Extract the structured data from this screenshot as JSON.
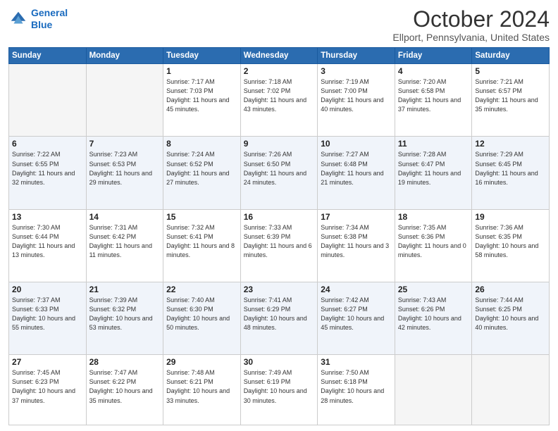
{
  "logo": {
    "line1": "General",
    "line2": "Blue"
  },
  "title": "October 2024",
  "subtitle": "Ellport, Pennsylvania, United States",
  "weekdays": [
    "Sunday",
    "Monday",
    "Tuesday",
    "Wednesday",
    "Thursday",
    "Friday",
    "Saturday"
  ],
  "weeks": [
    [
      {
        "day": "",
        "empty": true
      },
      {
        "day": "",
        "empty": true
      },
      {
        "day": "1",
        "sunrise": "Sunrise: 7:17 AM",
        "sunset": "Sunset: 7:03 PM",
        "daylight": "Daylight: 11 hours and 45 minutes."
      },
      {
        "day": "2",
        "sunrise": "Sunrise: 7:18 AM",
        "sunset": "Sunset: 7:02 PM",
        "daylight": "Daylight: 11 hours and 43 minutes."
      },
      {
        "day": "3",
        "sunrise": "Sunrise: 7:19 AM",
        "sunset": "Sunset: 7:00 PM",
        "daylight": "Daylight: 11 hours and 40 minutes."
      },
      {
        "day": "4",
        "sunrise": "Sunrise: 7:20 AM",
        "sunset": "Sunset: 6:58 PM",
        "daylight": "Daylight: 11 hours and 37 minutes."
      },
      {
        "day": "5",
        "sunrise": "Sunrise: 7:21 AM",
        "sunset": "Sunset: 6:57 PM",
        "daylight": "Daylight: 11 hours and 35 minutes."
      }
    ],
    [
      {
        "day": "6",
        "sunrise": "Sunrise: 7:22 AM",
        "sunset": "Sunset: 6:55 PM",
        "daylight": "Daylight: 11 hours and 32 minutes."
      },
      {
        "day": "7",
        "sunrise": "Sunrise: 7:23 AM",
        "sunset": "Sunset: 6:53 PM",
        "daylight": "Daylight: 11 hours and 29 minutes."
      },
      {
        "day": "8",
        "sunrise": "Sunrise: 7:24 AM",
        "sunset": "Sunset: 6:52 PM",
        "daylight": "Daylight: 11 hours and 27 minutes."
      },
      {
        "day": "9",
        "sunrise": "Sunrise: 7:26 AM",
        "sunset": "Sunset: 6:50 PM",
        "daylight": "Daylight: 11 hours and 24 minutes."
      },
      {
        "day": "10",
        "sunrise": "Sunrise: 7:27 AM",
        "sunset": "Sunset: 6:48 PM",
        "daylight": "Daylight: 11 hours and 21 minutes."
      },
      {
        "day": "11",
        "sunrise": "Sunrise: 7:28 AM",
        "sunset": "Sunset: 6:47 PM",
        "daylight": "Daylight: 11 hours and 19 minutes."
      },
      {
        "day": "12",
        "sunrise": "Sunrise: 7:29 AM",
        "sunset": "Sunset: 6:45 PM",
        "daylight": "Daylight: 11 hours and 16 minutes."
      }
    ],
    [
      {
        "day": "13",
        "sunrise": "Sunrise: 7:30 AM",
        "sunset": "Sunset: 6:44 PM",
        "daylight": "Daylight: 11 hours and 13 minutes."
      },
      {
        "day": "14",
        "sunrise": "Sunrise: 7:31 AM",
        "sunset": "Sunset: 6:42 PM",
        "daylight": "Daylight: 11 hours and 11 minutes."
      },
      {
        "day": "15",
        "sunrise": "Sunrise: 7:32 AM",
        "sunset": "Sunset: 6:41 PM",
        "daylight": "Daylight: 11 hours and 8 minutes."
      },
      {
        "day": "16",
        "sunrise": "Sunrise: 7:33 AM",
        "sunset": "Sunset: 6:39 PM",
        "daylight": "Daylight: 11 hours and 6 minutes."
      },
      {
        "day": "17",
        "sunrise": "Sunrise: 7:34 AM",
        "sunset": "Sunset: 6:38 PM",
        "daylight": "Daylight: 11 hours and 3 minutes."
      },
      {
        "day": "18",
        "sunrise": "Sunrise: 7:35 AM",
        "sunset": "Sunset: 6:36 PM",
        "daylight": "Daylight: 11 hours and 0 minutes."
      },
      {
        "day": "19",
        "sunrise": "Sunrise: 7:36 AM",
        "sunset": "Sunset: 6:35 PM",
        "daylight": "Daylight: 10 hours and 58 minutes."
      }
    ],
    [
      {
        "day": "20",
        "sunrise": "Sunrise: 7:37 AM",
        "sunset": "Sunset: 6:33 PM",
        "daylight": "Daylight: 10 hours and 55 minutes."
      },
      {
        "day": "21",
        "sunrise": "Sunrise: 7:39 AM",
        "sunset": "Sunset: 6:32 PM",
        "daylight": "Daylight: 10 hours and 53 minutes."
      },
      {
        "day": "22",
        "sunrise": "Sunrise: 7:40 AM",
        "sunset": "Sunset: 6:30 PM",
        "daylight": "Daylight: 10 hours and 50 minutes."
      },
      {
        "day": "23",
        "sunrise": "Sunrise: 7:41 AM",
        "sunset": "Sunset: 6:29 PM",
        "daylight": "Daylight: 10 hours and 48 minutes."
      },
      {
        "day": "24",
        "sunrise": "Sunrise: 7:42 AM",
        "sunset": "Sunset: 6:27 PM",
        "daylight": "Daylight: 10 hours and 45 minutes."
      },
      {
        "day": "25",
        "sunrise": "Sunrise: 7:43 AM",
        "sunset": "Sunset: 6:26 PM",
        "daylight": "Daylight: 10 hours and 42 minutes."
      },
      {
        "day": "26",
        "sunrise": "Sunrise: 7:44 AM",
        "sunset": "Sunset: 6:25 PM",
        "daylight": "Daylight: 10 hours and 40 minutes."
      }
    ],
    [
      {
        "day": "27",
        "sunrise": "Sunrise: 7:45 AM",
        "sunset": "Sunset: 6:23 PM",
        "daylight": "Daylight: 10 hours and 37 minutes."
      },
      {
        "day": "28",
        "sunrise": "Sunrise: 7:47 AM",
        "sunset": "Sunset: 6:22 PM",
        "daylight": "Daylight: 10 hours and 35 minutes."
      },
      {
        "day": "29",
        "sunrise": "Sunrise: 7:48 AM",
        "sunset": "Sunset: 6:21 PM",
        "daylight": "Daylight: 10 hours and 33 minutes."
      },
      {
        "day": "30",
        "sunrise": "Sunrise: 7:49 AM",
        "sunset": "Sunset: 6:19 PM",
        "daylight": "Daylight: 10 hours and 30 minutes."
      },
      {
        "day": "31",
        "sunrise": "Sunrise: 7:50 AM",
        "sunset": "Sunset: 6:18 PM",
        "daylight": "Daylight: 10 hours and 28 minutes."
      },
      {
        "day": "",
        "empty": true
      },
      {
        "day": "",
        "empty": true
      }
    ]
  ]
}
